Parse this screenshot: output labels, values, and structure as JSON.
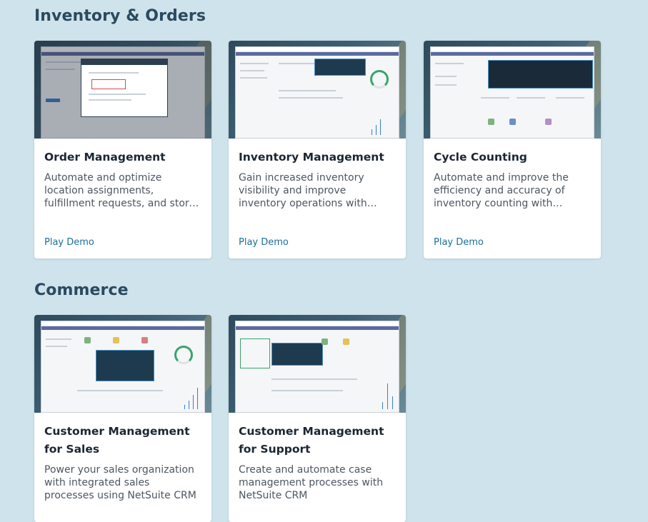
{
  "sections": [
    {
      "title": "Inventory & Orders",
      "cards": [
        {
          "title": "Order Management",
          "description": "Automate and optimize location assignments, fulfillment requests, and store pickup…",
          "cta": "Play Demo",
          "thumbnail": "netsuite-order-management-screenshot"
        },
        {
          "title": "Inventory Management",
          "description": "Gain increased inventory visibility and improve inventory operations with NetSuite…",
          "cta": "Play Demo",
          "thumbnail": "netsuite-inventory-management-screenshot"
        },
        {
          "title": "Cycle Counting",
          "description": "Automate and improve the efficiency and accuracy of inventory counting with NetSui…",
          "cta": "Play Demo",
          "thumbnail": "netsuite-cycle-counting-screenshot"
        }
      ]
    },
    {
      "title": "Commerce",
      "cards": [
        {
          "title": "Customer Management for Sales",
          "description": "Power your sales organization with integrated sales processes using NetSuite CRM",
          "cta": "Play Demo",
          "thumbnail": "netsuite-crm-sales-screenshot"
        },
        {
          "title": "Customer Management for Support",
          "description": "Create and automate case management processes with NetSuite CRM",
          "cta": "Play Demo",
          "thumbnail": "netsuite-crm-support-screenshot"
        }
      ]
    }
  ]
}
